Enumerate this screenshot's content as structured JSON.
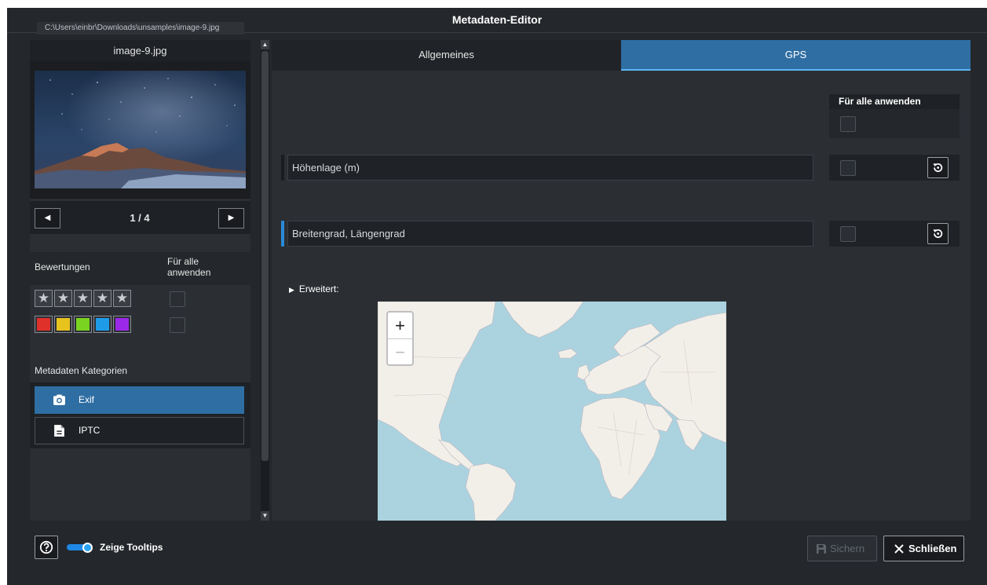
{
  "window": {
    "title": "Metadaten-Editor",
    "file_path": "C:\\Users\\einbr\\Downloads\\unsamples\\image-9.jpg"
  },
  "sidebar": {
    "file_name": "image-9.jpg",
    "page_indicator": "1 / 4",
    "ratings_label": "Bewertungen",
    "apply_all_label": "Für alle anwenden",
    "stars": [
      "★",
      "★",
      "★",
      "★",
      "★"
    ],
    "color_labels": [
      "#e0302a",
      "#e8c21d",
      "#7ad320",
      "#1e9be8",
      "#9b28e8"
    ],
    "categories_label": "Metadaten Kategorien",
    "categories": [
      {
        "label": "Exif",
        "icon": "camera-icon",
        "selected": true
      },
      {
        "label": "IPTC",
        "icon": "document-icon",
        "selected": false
      }
    ]
  },
  "tabs": [
    {
      "label": "Allgemeines",
      "active": false
    },
    {
      "label": "GPS",
      "active": true
    }
  ],
  "gps": {
    "apply_all_label": "Für alle anwenden",
    "altitude_placeholder": "Höhenlage (m)",
    "coordinates_placeholder": "Breitengrad, Längengrad",
    "advanced_label": "Erweitert:",
    "zoom_in": "+",
    "zoom_out": "−"
  },
  "footer": {
    "tooltip_toggle_label": "Zeige Tooltips",
    "tooltip_toggle_on": true,
    "save_label": "Sichern",
    "close_label": "Schließen"
  },
  "colors": {
    "accent": "#2f6ea3",
    "accent_light": "#5cb6f2",
    "background": "#24272b"
  }
}
